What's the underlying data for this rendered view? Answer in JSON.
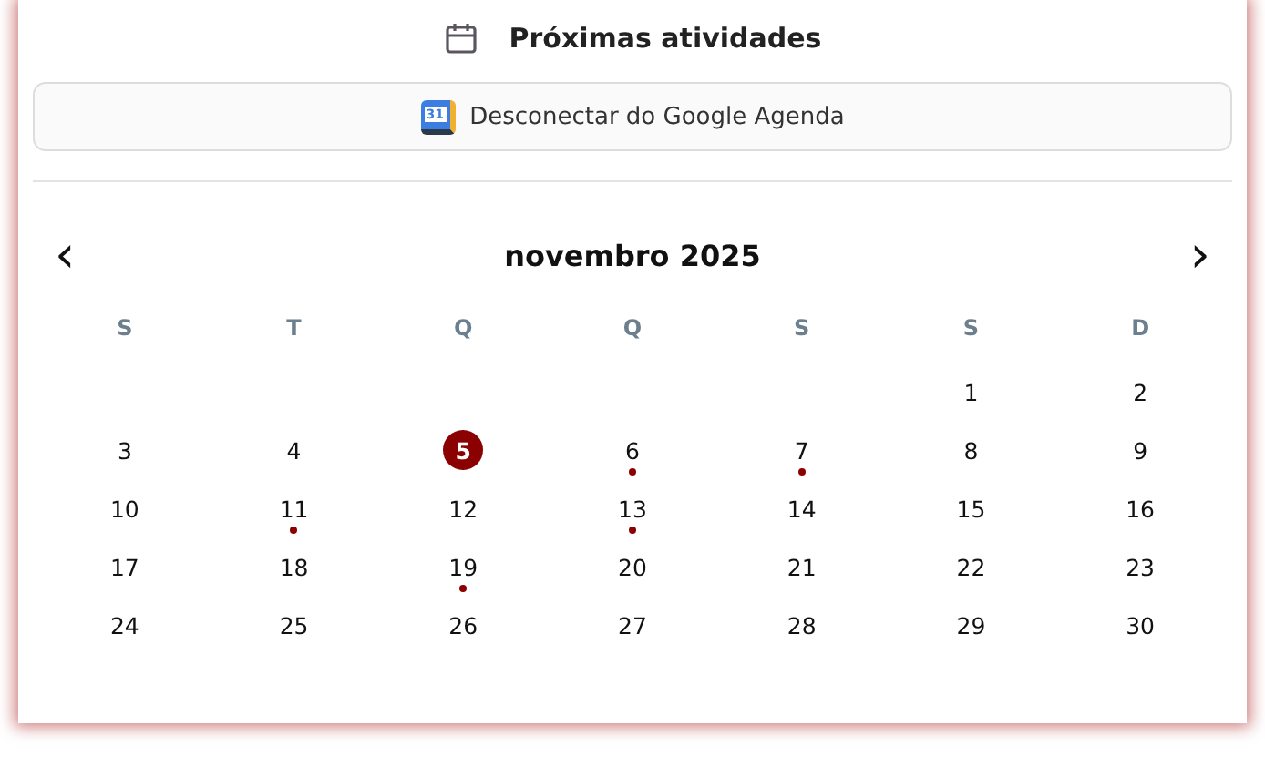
{
  "header": {
    "title": "Próximas atividades"
  },
  "google_button": {
    "label": "Desconectar do Google Agenda",
    "badge": "31"
  },
  "calendar": {
    "month": "novembro 2025",
    "prev": "‹",
    "next": "›",
    "weekdays": [
      "S",
      "T",
      "Q",
      "Q",
      "S",
      "S",
      "D"
    ],
    "weeks": [
      [
        {
          "label": "1",
          "today": false,
          "has_event": false
        },
        {
          "label": "2",
          "today": false,
          "has_event": false
        }
      ],
      [
        {
          "label": "3",
          "today": false,
          "has_event": false
        },
        {
          "label": "4",
          "today": false,
          "has_event": false
        },
        {
          "label": "5",
          "today": true,
          "has_event": false
        },
        {
          "label": "6",
          "today": false,
          "has_event": true
        },
        {
          "label": "7",
          "today": false,
          "has_event": true
        },
        {
          "label": "8",
          "today": false,
          "has_event": false
        },
        {
          "label": "9",
          "today": false,
          "has_event": false
        }
      ],
      [
        {
          "label": "10",
          "today": false,
          "has_event": false
        },
        {
          "label": "11",
          "today": false,
          "has_event": true
        },
        {
          "label": "12",
          "today": false,
          "has_event": false
        },
        {
          "label": "13",
          "today": false,
          "has_event": true
        },
        {
          "label": "14",
          "today": false,
          "has_event": false
        },
        {
          "label": "15",
          "today": false,
          "has_event": false
        },
        {
          "label": "16",
          "today": false,
          "has_event": false
        }
      ],
      [
        {
          "label": "17",
          "today": false,
          "has_event": false
        },
        {
          "label": "18",
          "today": false,
          "has_event": false
        },
        {
          "label": "19",
          "today": false,
          "has_event": true
        },
        {
          "label": "20",
          "today": false,
          "has_event": false
        },
        {
          "label": "21",
          "today": false,
          "has_event": false
        },
        {
          "label": "22",
          "today": false,
          "has_event": false
        },
        {
          "label": "23",
          "today": false,
          "has_event": false
        }
      ],
      [
        {
          "label": "24",
          "today": false,
          "has_event": false
        },
        {
          "label": "25",
          "today": false,
          "has_event": false
        },
        {
          "label": "26",
          "today": false,
          "has_event": false
        },
        {
          "label": "27",
          "today": false,
          "has_event": false
        },
        {
          "label": "28",
          "today": false,
          "has_event": false
        },
        {
          "label": "29",
          "today": false,
          "has_event": false
        },
        {
          "label": "30",
          "today": false,
          "has_event": false
        }
      ]
    ]
  }
}
